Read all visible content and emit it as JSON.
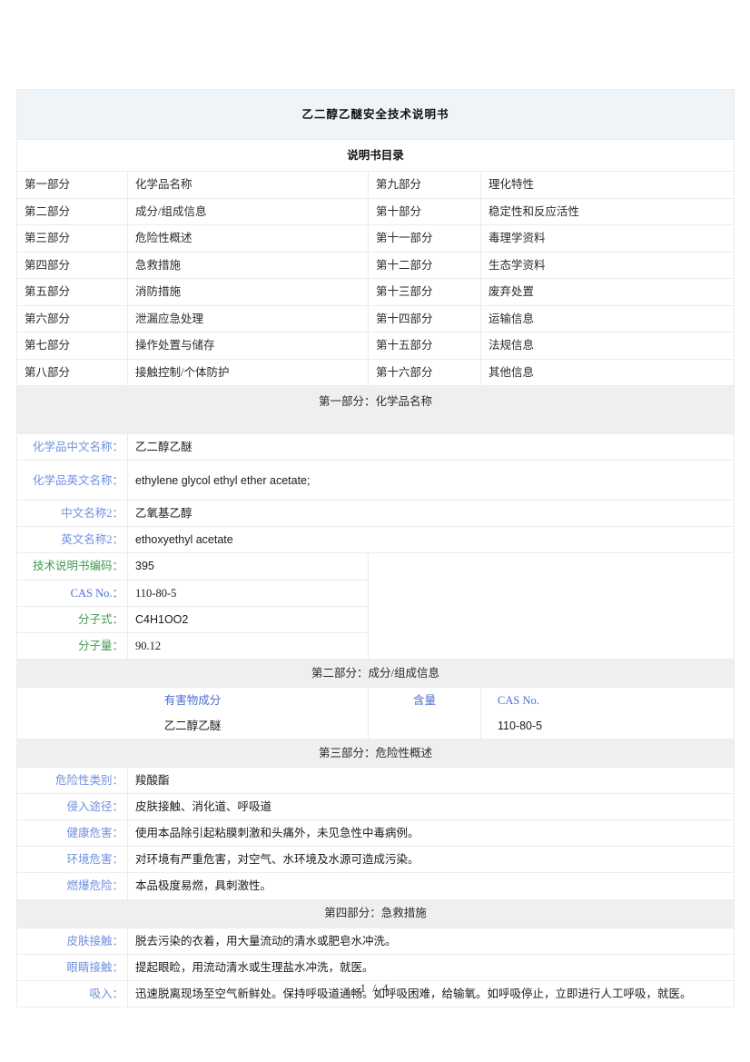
{
  "document": {
    "title": "乙二醇乙醚安全技术说明书",
    "toc_title": "说明书目录",
    "footer": "1 / 4"
  },
  "toc": {
    "rows": [
      {
        "left_no": "第一部分",
        "left_name": "化学品名称",
        "right_no": "第九部分",
        "right_name": "理化特性"
      },
      {
        "left_no": "第二部分",
        "left_name": "成分/组成信息",
        "right_no": "第十部分",
        "right_name": "稳定性和反应活性"
      },
      {
        "left_no": "第三部分",
        "left_name": "危险性概述",
        "right_no": "第十一部分",
        "right_name": "毒理学资料"
      },
      {
        "left_no": "第四部分",
        "left_name": "急救措施",
        "right_no": "第十二部分",
        "right_name": "生态学资料"
      },
      {
        "left_no": "第五部分",
        "left_name": "消防措施",
        "right_no": "第十三部分",
        "right_name": "废弃处置"
      },
      {
        "left_no": "第六部分",
        "left_name": "泄漏应急处理",
        "right_no": "第十四部分",
        "right_name": "运输信息"
      },
      {
        "left_no": "第七部分",
        "left_name": "操作处置与储存",
        "right_no": "第十五部分",
        "right_name": "法规信息"
      },
      {
        "left_no": "第八部分",
        "left_name": "接触控制/个体防护",
        "right_no": "第十六部分",
        "right_name": "其他信息"
      }
    ]
  },
  "part1": {
    "heading": "第一部分：化学品名称",
    "rows": [
      {
        "label": "化学品中文名称：",
        "value": "乙二醇乙醚"
      },
      {
        "label": "化学品英文名称：",
        "value": "ethylene glycol ethyl ether acetate;"
      },
      {
        "label": "中文名称2：",
        "value": "乙氧基乙醇"
      },
      {
        "label": "英文名称2：",
        "value": "ethoxyethyl acetate"
      },
      {
        "label": "技术说明书编码：",
        "value": "395"
      },
      {
        "label": "CAS No.：",
        "value": "110-80-5"
      },
      {
        "label": "分子式：",
        "value": "C4H1OO2"
      },
      {
        "label": "分子量：",
        "value": "90.12"
      }
    ]
  },
  "part2": {
    "heading": "第二部分：成分/组成信息",
    "columns": {
      "name": "有害物成分",
      "content": "含量",
      "cas": "CAS No."
    },
    "rows": [
      {
        "name": "乙二醇乙醚",
        "content": "",
        "cas": "110-80-5"
      }
    ]
  },
  "part3": {
    "heading": "第三部分：危险性概述",
    "rows": [
      {
        "label": "危险性类别：",
        "value": "羧酸酯"
      },
      {
        "label": "侵入途径：",
        "value": "皮肤接触、消化道、呼吸道"
      },
      {
        "label": "健康危害：",
        "value": "使用本品除引起粘膜刺激和头痛外，未见急性中毒病例。"
      },
      {
        "label": "环境危害：",
        "value": "对环境有严重危害，对空气、水环境及水源可造成污染。"
      },
      {
        "label": "燃爆危险：",
        "value": "本品极度易燃，具刺激性。"
      }
    ]
  },
  "part4": {
    "heading": "第四部分：急救措施",
    "rows": [
      {
        "label": "皮肤接触：",
        "value": "脱去污染的衣着，用大量流动的清水或肥皂水冲洗。"
      },
      {
        "label": "眼睛接触：",
        "value": "提起眼睑，用流动清水或生理盐水冲洗，就医。"
      },
      {
        "label": "吸入：",
        "value": "迅速脱离现场至空气新鲜处。保持呼吸道通畅。如呼吸困难，给输氧。如呼吸停止，立即进行人工呼吸，就医。"
      }
    ]
  },
  "colors": {
    "title_bg": "#eff4f8",
    "section_bg": "#efefef",
    "label_blue": "#6f8fe0",
    "label_blue_strong": "#4a6fd4",
    "label_green": "#3f9a52",
    "border": "#ececec"
  }
}
